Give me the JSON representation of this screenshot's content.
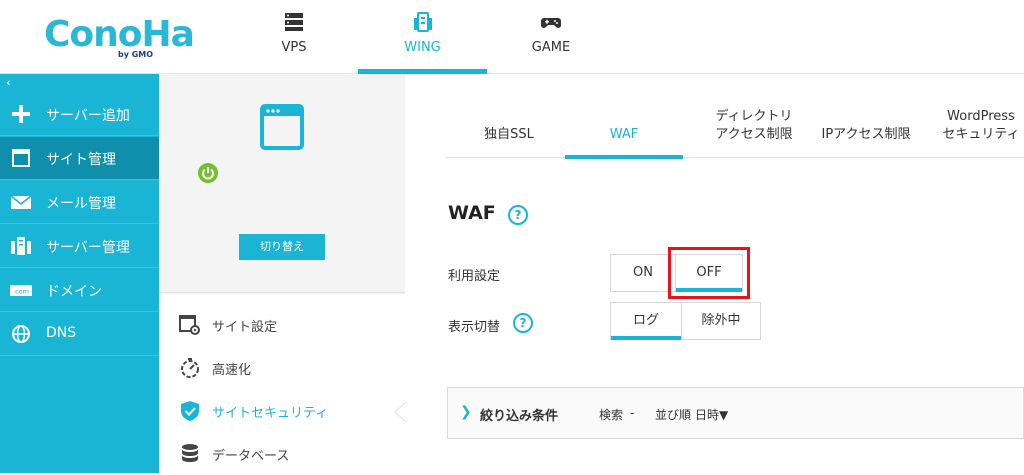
{
  "header": {
    "logo": {
      "text": "ConoHa",
      "sub": "by GMO"
    },
    "services": [
      {
        "label": "VPS",
        "icon": "server-icon"
      },
      {
        "label": "WING",
        "icon": "building-icon",
        "active": true
      },
      {
        "label": "GAME",
        "icon": "gamepad-icon"
      }
    ]
  },
  "sidebar": {
    "collapse_icon": "‹",
    "items": [
      {
        "label": "サーバー追加",
        "icon": "plus-icon"
      },
      {
        "label": "サイト管理",
        "icon": "window-icon",
        "active": true
      },
      {
        "label": "メール管理",
        "icon": "mail-icon"
      },
      {
        "label": "サーバー管理",
        "icon": "server-stack-icon"
      },
      {
        "label": "ドメイン",
        "icon": "domain-icon",
        "icon_text": ".com"
      },
      {
        "label": "DNS",
        "icon": "globe-icon"
      }
    ]
  },
  "site_panel": {
    "switch_label": "切り替え",
    "menu": [
      {
        "label": "サイト設定",
        "icon": "site-settings-icon"
      },
      {
        "label": "高速化",
        "icon": "stopwatch-icon"
      },
      {
        "label": "サイトセキュリティ",
        "icon": "shield-check-icon",
        "active": true
      },
      {
        "label": "データベース",
        "icon": "database-icon"
      }
    ]
  },
  "main": {
    "tabs": [
      {
        "line1": "独自SSL",
        "line2": ""
      },
      {
        "line1": "WAF",
        "line2": "",
        "active": true
      },
      {
        "line1": "ディレクトリ",
        "line2": "アクセス制限"
      },
      {
        "line1": "IPアクセス制限",
        "line2": ""
      },
      {
        "line1": "WordPress",
        "line2": "セキュリティ"
      }
    ],
    "section_title": "WAF",
    "help_glyph": "?",
    "usage": {
      "label": "利用設定",
      "on": "ON",
      "off": "OFF",
      "selected": "OFF"
    },
    "display": {
      "label": "表示切替",
      "log": "ログ",
      "excluded": "除外中",
      "selected": "ログ"
    },
    "filter": {
      "chevron": "❯",
      "title": "絞り込み条件",
      "search_label": "検索",
      "search_value": "-",
      "sort_label": "並び順",
      "sort_value": "日時▼"
    }
  },
  "colors": {
    "accent": "#1ab5d4",
    "sidebar_active": "#0f8fac",
    "highlight": "#e3141c",
    "power": "#72c02c"
  }
}
